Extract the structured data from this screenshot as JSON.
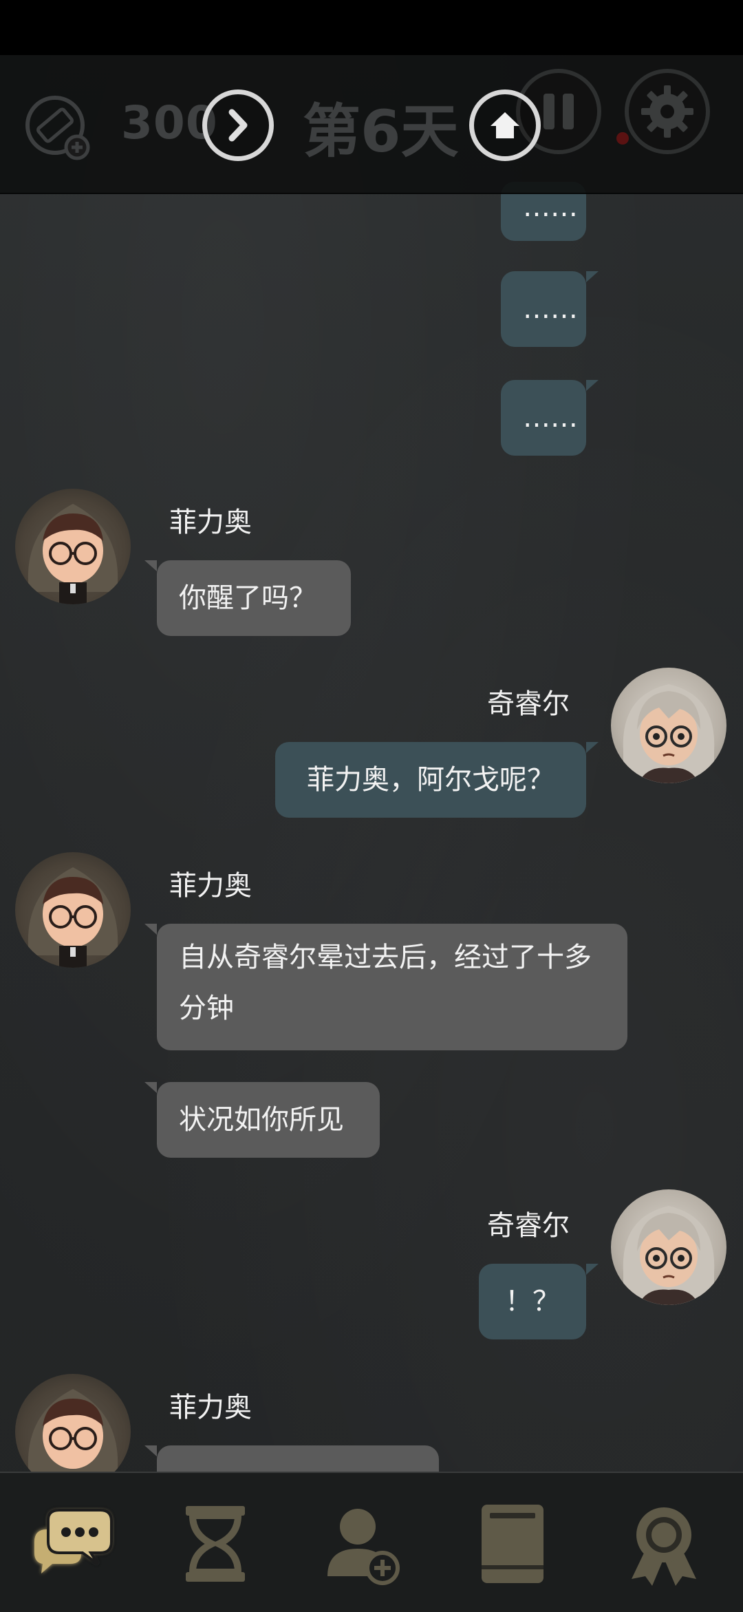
{
  "header": {
    "currency_count": "300",
    "day_label": "第6天"
  },
  "messages": {
    "m1": "……",
    "m2": "……",
    "m3": "……",
    "m4_name": "菲力奥",
    "m4": "你醒了吗？",
    "m5_name": "奇睿尔",
    "m5": "菲力奥，阿尔戈呢？",
    "m6_name": "菲力奥",
    "m6": "自从奇睿尔晕过去后，经过了十多分钟",
    "m7": "状况如你所见",
    "m8_name": "奇睿尔",
    "m8": "！？",
    "m9_name": "菲力奥"
  },
  "colors": {
    "accent_gold": "#d7c28d",
    "bubble_right": "#3c5057",
    "bubble_left": "#5b5b5b"
  },
  "icons": {
    "ticket": "ticket-plus-icon",
    "next": "chevron-right-icon",
    "home": "home-icon",
    "pause": "pause-icon",
    "settings": "gear-icon",
    "chat": "chat-bubbles-icon",
    "hourglass": "hourglass-icon",
    "add_contact": "add-contact-icon",
    "book": "book-icon",
    "award": "award-ribbon-icon"
  }
}
